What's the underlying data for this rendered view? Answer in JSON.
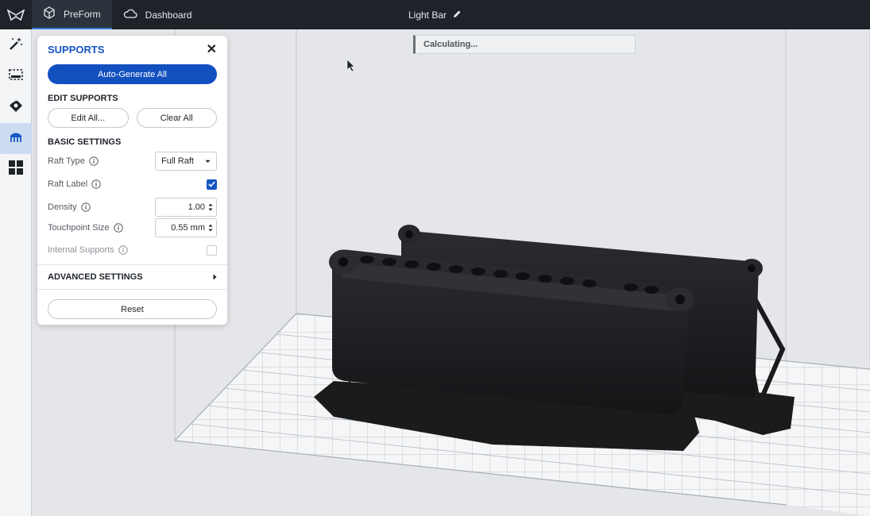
{
  "topbar": {
    "tabs": [
      {
        "label": "PreForm",
        "icon": "cube-icon",
        "active": true
      },
      {
        "label": "Dashboard",
        "icon": "cloud-icon",
        "active": false
      }
    ],
    "document_title": "Light Bar"
  },
  "toolbar": {
    "tools": [
      "magic-wand-icon",
      "selection-box-icon",
      "orientation-icon",
      "supports-icon",
      "layout-grid-icon"
    ],
    "active": "supports-icon"
  },
  "status": {
    "text": "Calculating..."
  },
  "supports_panel": {
    "title": "SUPPORTS",
    "auto_generate_label": "Auto-Generate All",
    "edit_section": "EDIT SUPPORTS",
    "edit_all_label": "Edit All...",
    "clear_all_label": "Clear All",
    "basic_section": "BASIC SETTINGS",
    "raft_type": {
      "label": "Raft Type",
      "value": "Full Raft"
    },
    "raft_label": {
      "label": "Raft Label",
      "checked": true
    },
    "density": {
      "label": "Density",
      "value": "1.00"
    },
    "touchpoint_size": {
      "label": "Touchpoint Size",
      "value": "0.55 mm"
    },
    "internal_supports": {
      "label": "Internal Supports",
      "checked": false
    },
    "advanced_section": "ADVANCED SETTINGS",
    "reset_label": "Reset"
  },
  "colors": {
    "accent": "#1250c0",
    "topbar": "#1e2329",
    "model": "#1c1d1f"
  }
}
